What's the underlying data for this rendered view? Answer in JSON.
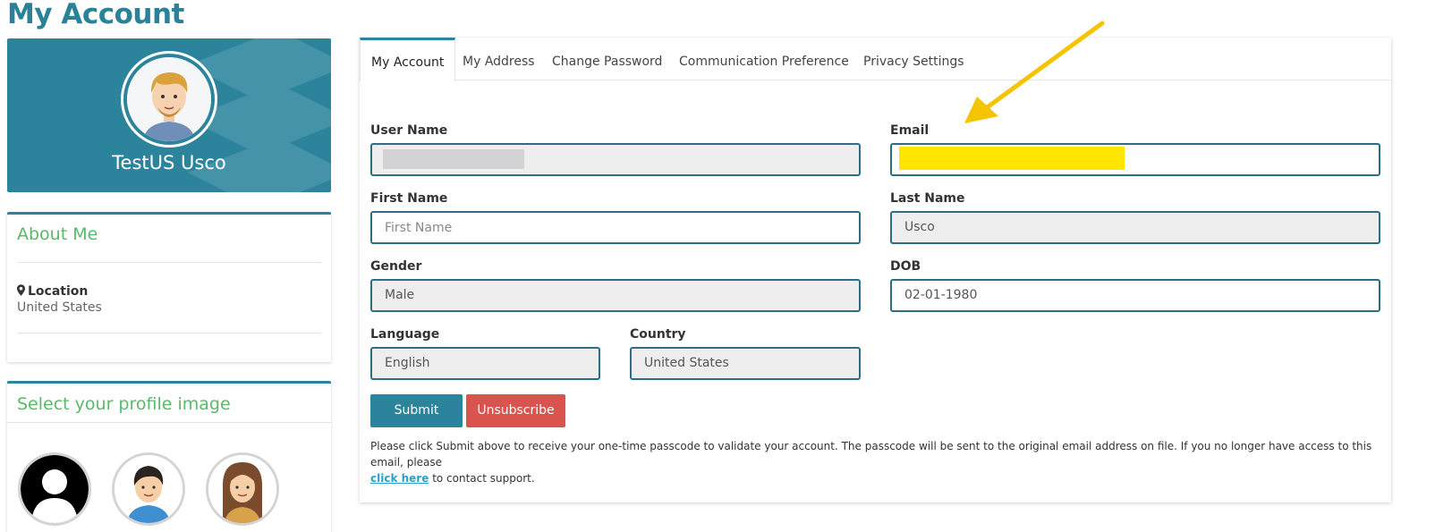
{
  "page": {
    "title": "My Account"
  },
  "profile": {
    "name": "TestUS Usco"
  },
  "about": {
    "title": "About Me",
    "location_label": "Location",
    "location_value": "United States"
  },
  "profile_images": {
    "title": "Select your profile image"
  },
  "tabs": [
    {
      "label": "My Account",
      "active": true
    },
    {
      "label": "My Address"
    },
    {
      "label": "Change Password"
    },
    {
      "label": "Communication Preference"
    },
    {
      "label": "Privacy Settings"
    }
  ],
  "form": {
    "username": {
      "label": "User Name",
      "value": ""
    },
    "email": {
      "label": "Email",
      "value": ""
    },
    "first_name": {
      "label": "First Name",
      "value": "",
      "placeholder": "First Name"
    },
    "last_name": {
      "label": "Last Name",
      "value": "Usco"
    },
    "gender": {
      "label": "Gender",
      "value": "Male"
    },
    "dob": {
      "label": "DOB",
      "value": "02-01-1980"
    },
    "language": {
      "label": "Language",
      "value": "English"
    },
    "country": {
      "label": "Country",
      "value": "United States"
    }
  },
  "buttons": {
    "submit": "Submit",
    "unsubscribe": "Unsubscribe"
  },
  "notice": {
    "text_before": "Please click Submit above to receive your one-time passcode to validate your account. The passcode will be sent to the original email address on file. If you no longer have access to this email, please",
    "link": "click here",
    "text_after": "to contact support."
  },
  "colors": {
    "accent": "#2b849c",
    "green": "#5bb86a",
    "danger": "#d9534f",
    "annotation": "#f5c400"
  }
}
